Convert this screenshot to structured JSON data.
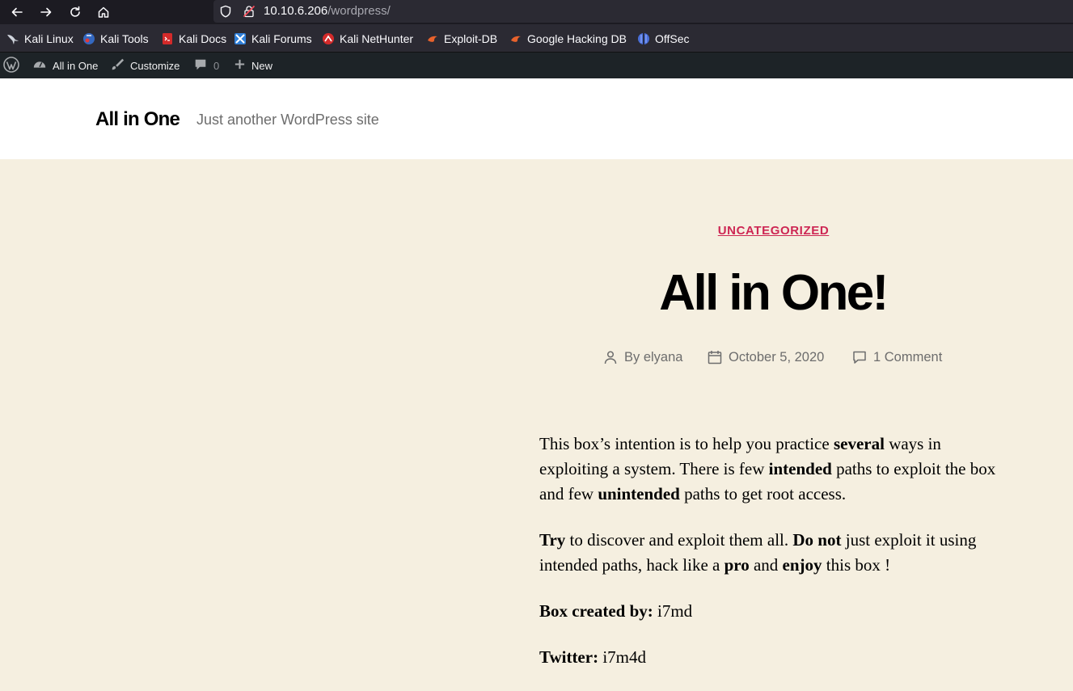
{
  "browser": {
    "url_host": "10.10.6.206",
    "url_path": "/wordpress/"
  },
  "bookmarks": [
    {
      "label": "Kali Linux",
      "icon": "kali-dragon-icon"
    },
    {
      "label": "Kali Tools",
      "icon": "kali-tools-icon"
    },
    {
      "label": "Kali Docs",
      "icon": "kali-docs-icon"
    },
    {
      "label": "Kali Forums",
      "icon": "kali-forums-icon"
    },
    {
      "label": "Kali NetHunter",
      "icon": "nethunter-icon"
    },
    {
      "label": "Exploit-DB",
      "icon": "exploit-db-icon"
    },
    {
      "label": "Google Hacking DB",
      "icon": "ghdb-icon"
    },
    {
      "label": "OffSec",
      "icon": "offsec-icon"
    }
  ],
  "adminbar": {
    "site_name": "All in One",
    "customize": "Customize",
    "comments_count": "0",
    "new": "New"
  },
  "site": {
    "title": "All in One",
    "description": "Just another WordPress site"
  },
  "post": {
    "category": "UNCATEGORIZED",
    "title": "All in One!",
    "author": "By elyana",
    "date": "October 5, 2020",
    "comments": "1 Comment",
    "p1": {
      "a": "This box’s intention is to help you practice ",
      "b": "several",
      "c": " ways in exploiting a system. There is few ",
      "d": "intended",
      "e": " paths to exploit the box and few ",
      "f": "unintended",
      "g": " paths to get root access."
    },
    "p2": {
      "a": "Try",
      "b": " to discover and exploit them all. ",
      "c": "Do not",
      "d": " just exploit it using intended paths, hack like a ",
      "e": "pro",
      "f": " and ",
      "g": "enjoy",
      "h": " this box !"
    },
    "p3": {
      "label": "Box created by:",
      "value": " i7md"
    },
    "p4": {
      "label": "Twitter:",
      "value": " i7m4d"
    }
  },
  "colors": {
    "background": "#f5efe0",
    "accent": "#cd2653",
    "adminbar": "#1d2327"
  }
}
